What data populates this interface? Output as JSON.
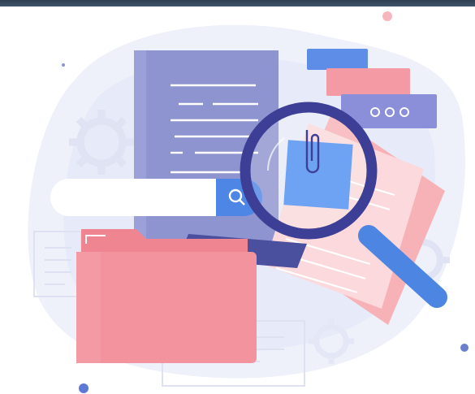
{
  "illustration": {
    "subject": "document-search",
    "icons": [
      "folder-icon",
      "document-icon",
      "magnifying-glass-icon",
      "search-icon",
      "paperclip-icon",
      "gear-icon",
      "more-dots-icon"
    ],
    "colors": {
      "background_blob": "#eef0fa",
      "document_purple": "#8e94cf",
      "document_lines": "#ffffff",
      "search_bar": "#ffffff",
      "search_button": "#4e86e6",
      "folder_pink": "#f2939d",
      "folder_back": "#ee8590",
      "paper_pink": "#fbd9dc",
      "sticky_note": "#6ea2f3",
      "magnifier_ring": "#3c3f95",
      "magnifier_handle": "#4d86e2",
      "tab_blue": "#5e8de8",
      "tab_pink": "#f39aa5",
      "tab_purple": "#8b8ed8",
      "gear_outline": "#e1e4f3",
      "accent_dot_pink": "#f6b6bd",
      "accent_dot_blue": "#5e78d6"
    }
  }
}
